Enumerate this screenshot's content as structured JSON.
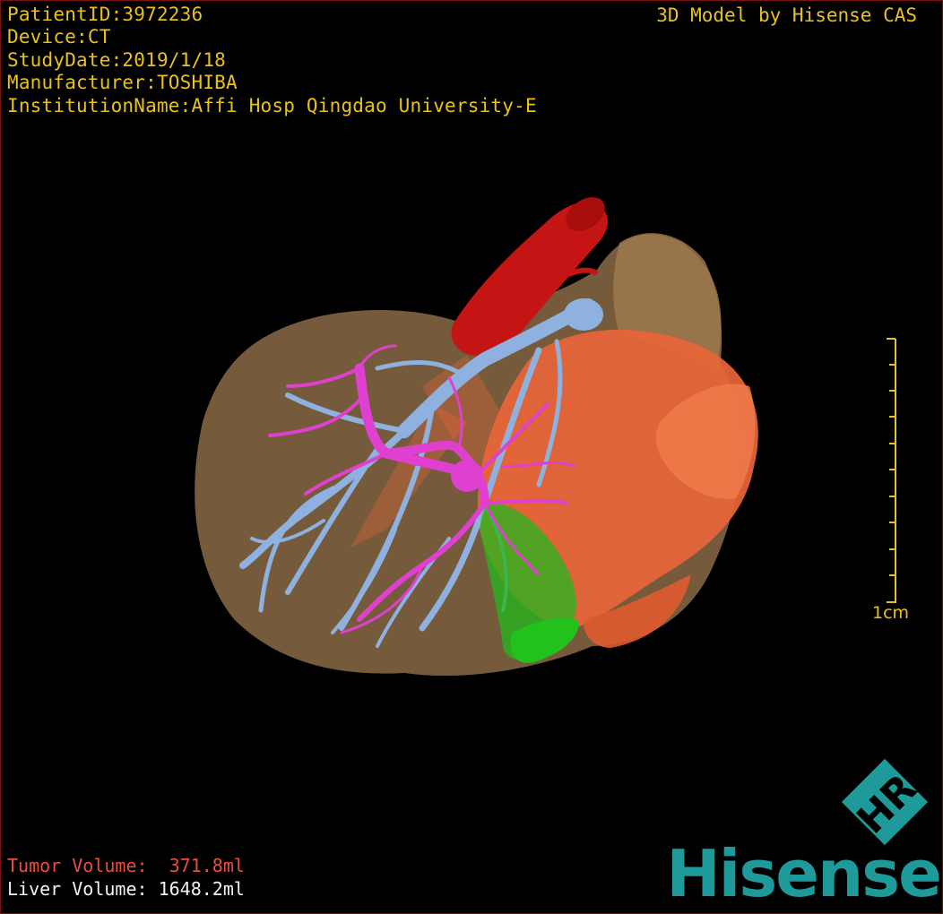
{
  "viewer": {
    "brand_text": "3D Model by Hisense CAS",
    "info": {
      "patient_id": "PatientID:3972236",
      "device": "Device:CT",
      "study_date": "StudyDate:2019/1/18",
      "manufacturer": "Manufacturer:TOSHIBA",
      "institution": "InstitutionName:Affi Hosp Qingdao University-E"
    },
    "scale_bar": {
      "label": "1cm"
    },
    "volumes": {
      "tumor": "Tumor Volume:  371.8ml",
      "liver": "Liver Volume: 1648.2ml"
    },
    "logo": {
      "mark_text": "HR",
      "word": "Hisense"
    }
  },
  "colors": {
    "info_text": "#e8c21c",
    "tumor_text": "#e54f43",
    "liver_text": "#f2f2f2",
    "brand_teal": "#1f9a9a",
    "liver": "#8a6b45",
    "tumor": "#e8653a",
    "artery": "#c41414",
    "portal_vein": "#8fb1e0",
    "hepatic_vessel": "#e040d0",
    "gallbladder": "#22b81c"
  }
}
